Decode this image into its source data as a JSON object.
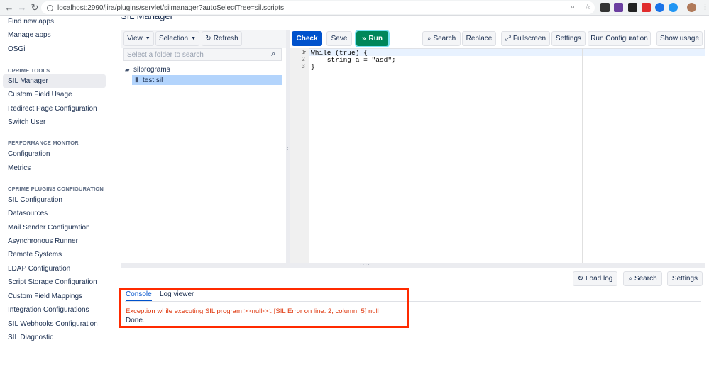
{
  "browser": {
    "back": "←",
    "forward": "→",
    "reload": "↻",
    "url": "localhost:2990/jira/plugins/servlet/silmanager?autoSelectTree=sil.scripts"
  },
  "page_title": "SIL Manager",
  "sidebar": {
    "items_top": [
      "Find new apps",
      "Manage apps",
      "OSGi"
    ],
    "sections": [
      {
        "heading": "CPRIME TOOLS",
        "items": [
          "SIL Manager",
          "Custom Field Usage",
          "Redirect Page Configuration",
          "Switch User"
        ]
      },
      {
        "heading": "PERFORMANCE MONITOR",
        "items": [
          "Configuration",
          "Metrics"
        ]
      },
      {
        "heading": "CPRIME PLUGINS CONFIGURATION",
        "items": [
          "SIL Configuration",
          "Datasources",
          "Mail Sender Configuration",
          "Asynchronous Runner",
          "Remote Systems",
          "LDAP Configuration",
          "Script Storage Configuration",
          "Custom Field Mappings",
          "Integration Configurations",
          "SIL Webhooks Configuration",
          "SIL Diagnostic"
        ]
      }
    ],
    "active": "SIL Manager"
  },
  "tree_toolbar": {
    "view": "View",
    "selection": "Selection",
    "refresh": "Refresh"
  },
  "tree_search": {
    "placeholder": "Select a folder to search"
  },
  "tree": {
    "folder": "silprograms",
    "file": "test.sil"
  },
  "editor_toolbar": {
    "check": "Check",
    "save": "Save",
    "run": "Run",
    "search": "Search",
    "replace": "Replace",
    "fullscreen": "Fullscreen",
    "settings": "Settings",
    "run_configuration": "Run Configuration",
    "show_usage": "Show usage"
  },
  "code": {
    "line_numbers": [
      "1",
      "2",
      "3"
    ],
    "lines": [
      "While (true) {",
      "    string a = \"asd\";",
      "}"
    ]
  },
  "lower_toolbar": {
    "load_log": "Load log",
    "search": "Search",
    "settings": "Settings"
  },
  "tabs": {
    "console": "Console",
    "log_viewer": "Log viewer"
  },
  "console": {
    "error": "Exception while executing SIL program >>null<<: [SIL Error on line: 2, column: 5] null",
    "status": "Done."
  },
  "colors": {
    "primary": "#0052cc",
    "run": "#00875a",
    "error": "#de350b",
    "highlight_box": "#ff2a00"
  }
}
